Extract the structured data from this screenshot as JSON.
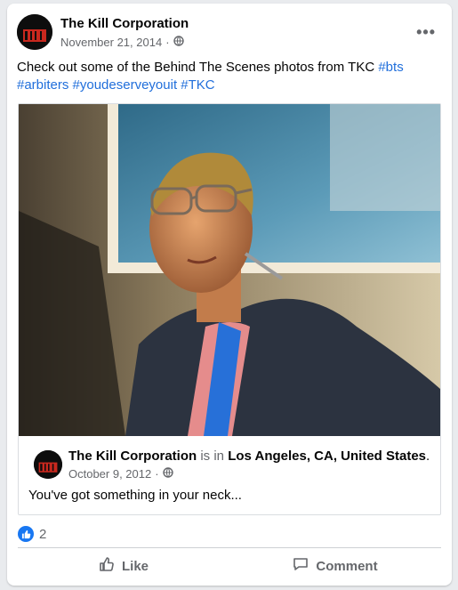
{
  "post": {
    "page_name": "The Kill Corporation",
    "date": "November 21, 2014",
    "separator": "·",
    "privacy_icon": "globe-icon",
    "more_icon": "more-options-icon",
    "more_label": "•••",
    "text_plain": "Check out some of the Behind The Scenes photos from TKC",
    "hashtags": [
      "#bts",
      "#arbiters",
      "#youdeserveyouit",
      "#TKC"
    ]
  },
  "shared": {
    "page_name": "The Kill Corporation",
    "is_in": "is in",
    "location": "Los Angeles, CA, United States",
    "period": ".",
    "date": "October 9, 2012",
    "separator": "·",
    "caption": "You've got something in your neck..."
  },
  "reactions": {
    "icon": "like-reaction-icon",
    "count": "2"
  },
  "actions": {
    "like": "Like",
    "comment": "Comment"
  },
  "colors": {
    "accent": "#216fdb",
    "like_blue": "#1877f2",
    "muted": "#65676b"
  }
}
